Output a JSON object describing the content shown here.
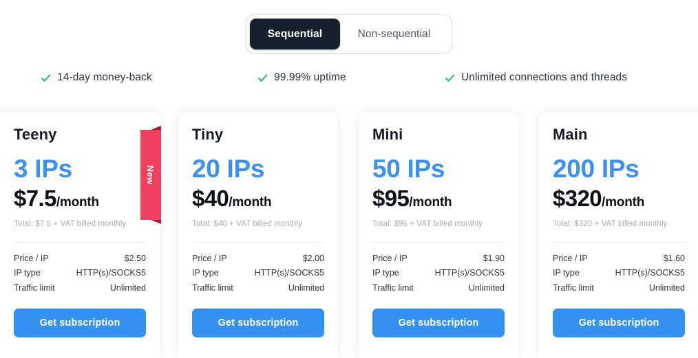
{
  "colors": {
    "accent_blue": "#3d90ef",
    "cta_blue": "#3491ef",
    "toggle_active_bg": "#16202e",
    "check_green": "#21b573",
    "ribbon_red": "#ef4060",
    "ribbon_fold_red": "#9e1f33",
    "page_bg": "#ffffff"
  },
  "toggle": {
    "name": "ip-sequence-toggle",
    "options": [
      {
        "label": "Sequential",
        "selected": true
      },
      {
        "label": "Non-sequential",
        "selected": false
      }
    ]
  },
  "features": [
    {
      "icon": "check-icon",
      "label": "14-day money-back"
    },
    {
      "icon": "check-icon",
      "label": "99.99% uptime"
    },
    {
      "icon": "check-icon",
      "label": "Unlimited connections and threads"
    }
  ],
  "spec_labels": {
    "price_per_ip": "Price / IP",
    "ip_type": "IP type",
    "traffic_limit": "Traffic limit"
  },
  "cta_label": "Get subscription",
  "badge": {
    "label": "New"
  },
  "plans": [
    {
      "name": "Teeny",
      "ips": "3 IPs",
      "price_amount": "$7.5",
      "price_period": "/month",
      "total_note": "Total: $7.5 + VAT billed monthly",
      "price_per_ip": "$2.50",
      "ip_type": "HTTP(s)/SOCKS5",
      "traffic_limit": "Unlimited",
      "badge": "New",
      "cta": "Get subscription"
    },
    {
      "name": "Tiny",
      "ips": "20 IPs",
      "price_amount": "$40",
      "price_period": "/month",
      "total_note": "Total: $40 + VAT billed monthly",
      "price_per_ip": "$2.00",
      "ip_type": "HTTP(s)/SOCKS5",
      "traffic_limit": "Unlimited",
      "badge": null,
      "cta": "Get subscription"
    },
    {
      "name": "Mini",
      "ips": "50 IPs",
      "price_amount": "$95",
      "price_period": "/month",
      "total_note": "Total: $95 + VAT billed monthly",
      "price_per_ip": "$1.90",
      "ip_type": "HTTP(s)/SOCKS5",
      "traffic_limit": "Unlimited",
      "badge": null,
      "cta": "Get subscription"
    },
    {
      "name": "Main",
      "ips": "200 IPs",
      "price_amount": "$320",
      "price_period": "/month",
      "total_note": "Total: $320 + VAT billed monthly",
      "price_per_ip": "$1.60",
      "ip_type": "HTTP(s)/SOCKS5",
      "traffic_limit": "Unlimited",
      "badge": null,
      "cta": "Get subscription"
    }
  ]
}
